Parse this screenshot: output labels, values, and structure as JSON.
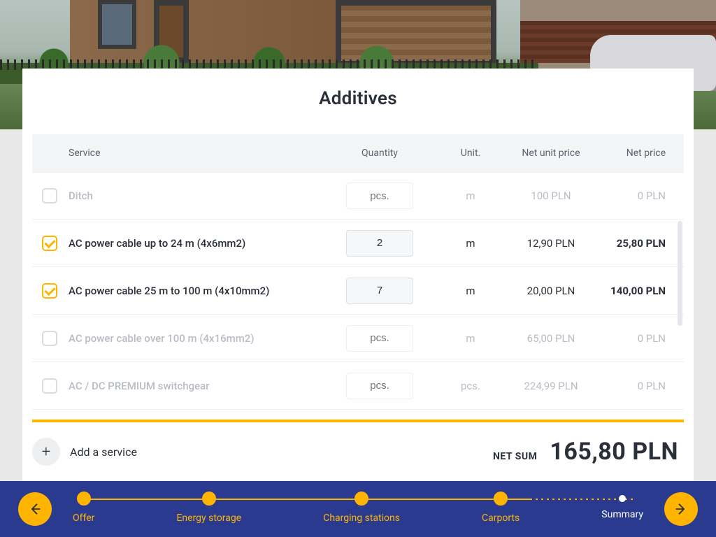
{
  "page_title": "Additives",
  "table": {
    "headers": {
      "service": "Service",
      "quantity": "Quantity",
      "unit": "Unit.",
      "unit_price": "Net unit price",
      "net_price": "Net price"
    },
    "rows": [
      {
        "checked": false,
        "service": "Ditch",
        "qty": "pcs.",
        "unit": "m",
        "unit_price": "100 PLN",
        "net_price": "0 PLN"
      },
      {
        "checked": true,
        "service": "AC power cable up to 24 m (4x6mm2)",
        "qty": "2",
        "unit": "m",
        "unit_price": "12,90 PLN",
        "net_price": "25,80 PLN"
      },
      {
        "checked": true,
        "service": "AC power cable 25 m to 100 m (4x10mm2)",
        "qty": "7",
        "unit": "m",
        "unit_price": "20,00 PLN",
        "net_price": "140,00 PLN"
      },
      {
        "checked": false,
        "service": "AC power cable over 100 m (4x16mm2)",
        "qty": "pcs.",
        "unit": "m",
        "unit_price": "65,00 PLN",
        "net_price": "0 PLN"
      },
      {
        "checked": false,
        "service": "AC / DC PREMIUM switchgear",
        "qty": "pcs.",
        "unit": "pcs.",
        "unit_price": "224,99 PLN",
        "net_price": "0 PLN"
      }
    ]
  },
  "add_service_label": "Add a service",
  "net_sum_label": "NET SUM",
  "net_sum_value": "165,80 PLN",
  "stepper": {
    "steps": [
      {
        "label": "Offer",
        "state": "done"
      },
      {
        "label": "Energy storage",
        "state": "done"
      },
      {
        "label": "Charging stations",
        "state": "done"
      },
      {
        "label": "Carports",
        "state": "done"
      },
      {
        "label": "Summary",
        "state": "current"
      }
    ]
  }
}
